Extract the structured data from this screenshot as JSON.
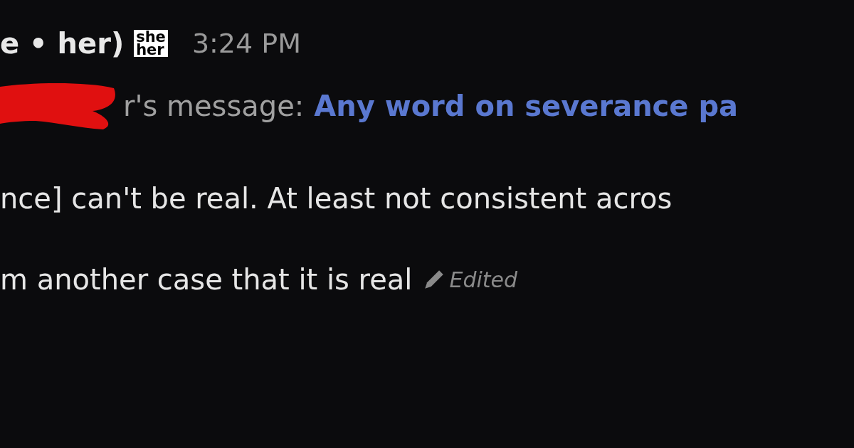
{
  "header": {
    "author_fragment": "e • her)",
    "pronoun_badge": [
      "she",
      "her"
    ],
    "time": "3:24 PM"
  },
  "reply": {
    "redacted": true,
    "prefix": "r's message:",
    "quoted": "Any word on severance pa"
  },
  "body": [
    {
      "text": "nce] can't be real. At least not consistent acros"
    },
    {
      "text": "m another case that it is real",
      "edited_label": "Edited"
    }
  ]
}
